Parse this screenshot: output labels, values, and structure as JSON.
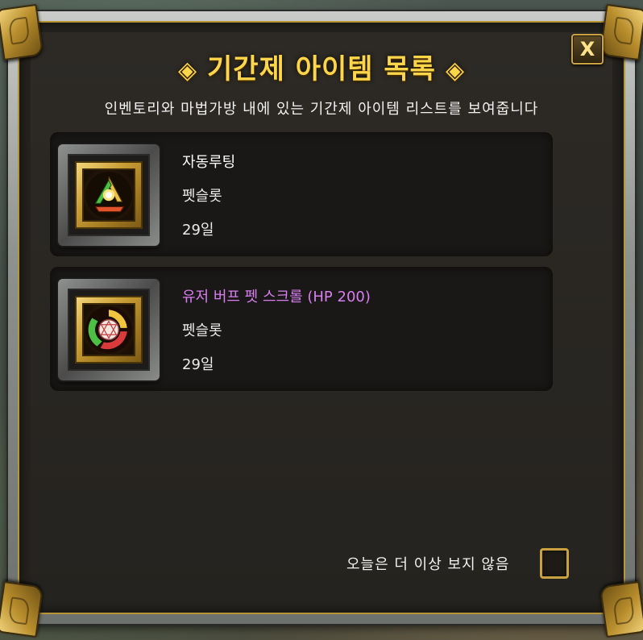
{
  "dialog": {
    "title": "기간제 아이템 목록",
    "title_decoration": "◈",
    "close_label": "X",
    "subtitle": "인벤토리와 마법가방 내에 있는 기간제 아이템 리스트를 보여줍니다"
  },
  "items": [
    {
      "name": "자동루팅",
      "type": "펫슬롯",
      "duration": "29일",
      "icon": "auto-loot-icon",
      "name_color": "#ffffff"
    },
    {
      "name": "유저 버프 펫 스크롤 (HP 200)",
      "type": "펫슬롯",
      "duration": "29일",
      "icon": "buff-scroll-icon",
      "name_color": "#d77ef0"
    }
  ],
  "footer": {
    "dont_show_label": "오늘은 더 이상 보지 않음",
    "dont_show_checked": false
  },
  "colors": {
    "title": "#ffd54a",
    "accent_gold": "#c9a13f",
    "special_item": "#d77ef0"
  }
}
